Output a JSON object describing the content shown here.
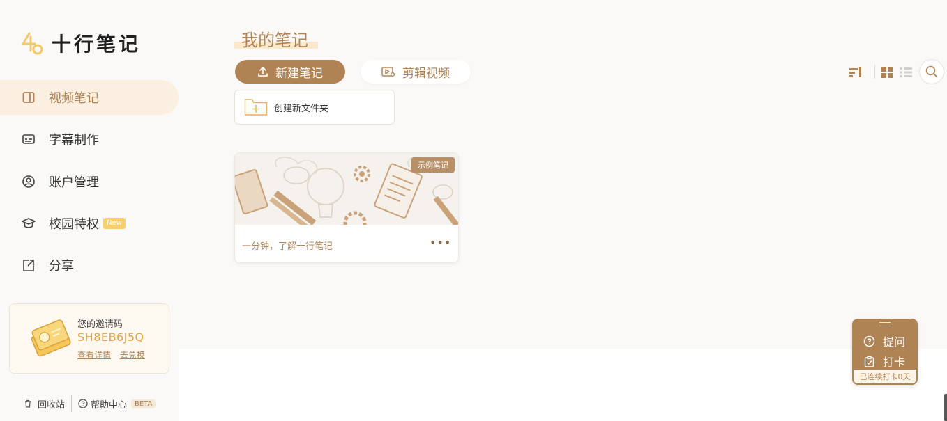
{
  "app": {
    "name": "十行笔记"
  },
  "sidebar": {
    "items": [
      {
        "label": "视频笔记",
        "icon": "panel-icon",
        "active": true
      },
      {
        "label": "字幕制作",
        "icon": "subtitle-icon",
        "active": false
      },
      {
        "label": "账户管理",
        "icon": "user-circle-icon",
        "active": false
      },
      {
        "label": "校园特权",
        "icon": "graduation-cap-icon",
        "active": false,
        "badge": "New"
      },
      {
        "label": "分享",
        "icon": "share-icon",
        "active": false
      }
    ],
    "invite": {
      "title": "您的邀请码",
      "code": "SH8EB6J5Q",
      "details_link": "查看详情",
      "redeem_link": "去兑换"
    },
    "footer": {
      "recycle": "回收站",
      "help": "帮助中心",
      "beta": "BETA"
    }
  },
  "main": {
    "title": "我的笔记",
    "new_note_button": "新建笔记",
    "edit_video_button": "剪辑视频",
    "create_folder": "创建新文件夹",
    "notes": [
      {
        "title": "一分钟，了解十行笔记",
        "badge": "示例笔记"
      }
    ]
  },
  "float_widget": {
    "ask": "提问",
    "checkin": "打卡",
    "streak": "已连续打卡0天"
  },
  "colors": {
    "accent": "#b08355",
    "accent_light": "#fbefe1",
    "code": "#e6a33e",
    "background": "#fbf9f7"
  }
}
